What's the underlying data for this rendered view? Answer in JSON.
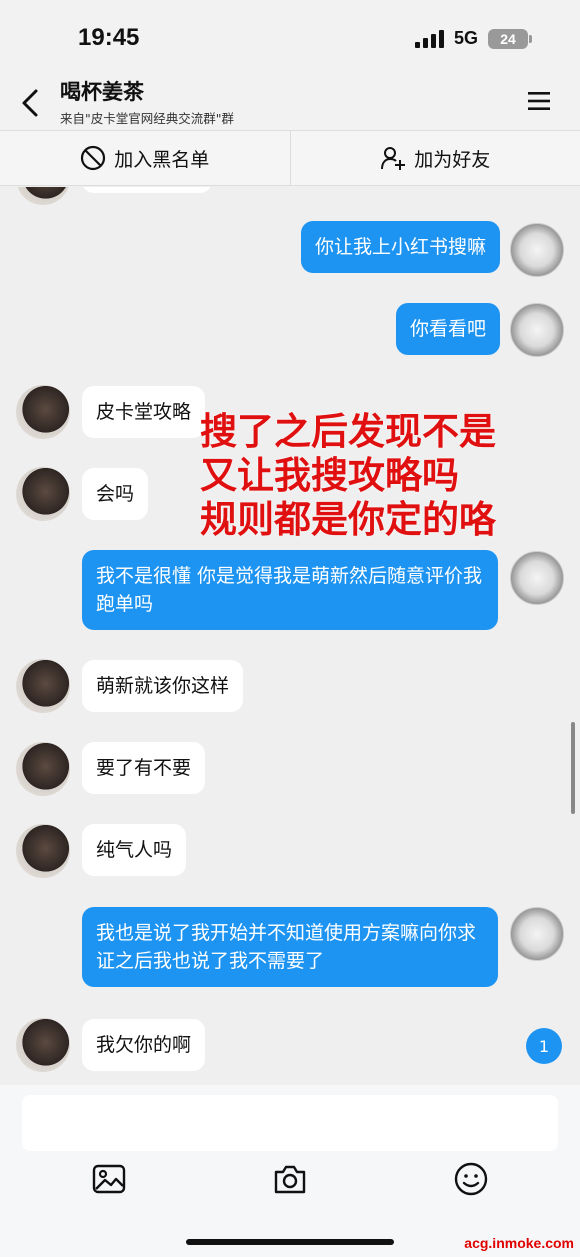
{
  "status": {
    "time": "19:45",
    "network": "5G",
    "battery": "24"
  },
  "header": {
    "title": "喝杯姜茶",
    "subtitle": "来自\"皮卡堂官网经典交流群\"群"
  },
  "actions": {
    "blacklist": "加入黑名单",
    "add_friend": "加为好友"
  },
  "messages": [
    {
      "from": "me",
      "text": "你让我上小红书搜嘛"
    },
    {
      "from": "me",
      "text": "你看看吧"
    },
    {
      "from": "other",
      "text": "皮卡堂攻略"
    },
    {
      "from": "other",
      "text": "会吗"
    },
    {
      "from": "me",
      "text": "我不是很懂 你是觉得我是萌新然后随意评价我跑单吗"
    },
    {
      "from": "other",
      "text": "萌新就该你这样"
    },
    {
      "from": "other",
      "text": "要了有不要"
    },
    {
      "from": "other",
      "text": "纯气人吗"
    },
    {
      "from": "me",
      "text": "我也是说了我开始并不知道使用方案嘛向你求证之后我也说了我不需要了"
    },
    {
      "from": "other",
      "text": "我欠你的啊"
    }
  ],
  "overlay_text": "搜了之后发现不是\n又让我搜攻略吗\n规则都是你定的咯",
  "unread_count": "1",
  "watermark": "acg.inmoke.com",
  "colors": {
    "bubble_me": "#1e94f2",
    "overlay": "#e01010"
  }
}
